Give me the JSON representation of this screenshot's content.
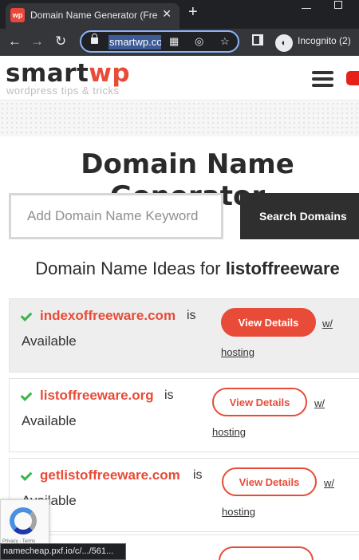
{
  "browser": {
    "tab_title": "Domain Name Generator (Fre",
    "tab_favicon_text": "wp",
    "url": "smartwp.co",
    "incognito_label": "Incognito (2)",
    "status_url": "namecheap.pxf.io/c/.../561..."
  },
  "site": {
    "logo_main": "smart",
    "logo_accent": "wp",
    "logo_tagline": "wordpress tips & tricks",
    "brand_color": "#e84b37"
  },
  "main": {
    "title": "Domain Name Generator",
    "search_placeholder": "Add Domain Name Keyword",
    "search_button": "Search Domains",
    "ideas_prefix": "Domain Name Ideas for",
    "keyword": "listoffreeware"
  },
  "results": [
    {
      "domain": "indexoffreeware.com",
      "is": "is",
      "status": "Available",
      "button": "View Details",
      "w": "w/",
      "hosting": "hosting"
    },
    {
      "domain": "listoffreeware.org",
      "is": "is",
      "status": "Available",
      "button": "View Details",
      "w": "w/",
      "hosting": "hosting"
    },
    {
      "domain": "getlistoffreeware.com",
      "is": "is",
      "status": "Available",
      "button": "View Details",
      "w": "w/",
      "hosting": "hosting"
    }
  ],
  "recaptcha_terms": "Privacy - Terms"
}
